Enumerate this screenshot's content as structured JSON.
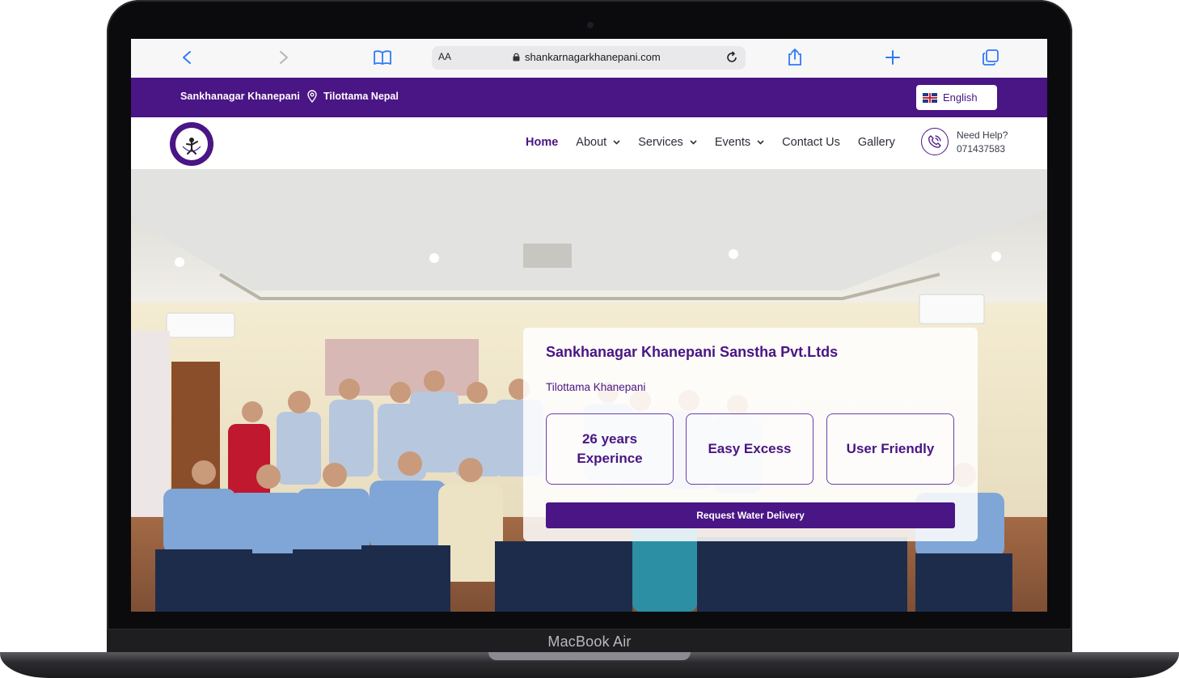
{
  "device": {
    "model_label": "MacBook Air"
  },
  "browser": {
    "text_size_label": "AA",
    "url": "shankarnagarkhanepani.com",
    "icons": [
      "back-icon",
      "forward-icon",
      "bookmarks-icon",
      "lock-icon",
      "reload-icon",
      "share-icon",
      "new-tab-icon",
      "tabs-icon"
    ]
  },
  "topbar": {
    "brand": "Sankhanagar Khanepani",
    "location": "Tilottama Nepal",
    "language": "English",
    "background": "#4a1584"
  },
  "nav": {
    "items": [
      {
        "label": "Home",
        "active": true,
        "dropdown": false
      },
      {
        "label": "About",
        "active": false,
        "dropdown": true
      },
      {
        "label": "Services",
        "active": false,
        "dropdown": true
      },
      {
        "label": "Events",
        "active": false,
        "dropdown": true
      },
      {
        "label": "Contact Us",
        "active": false,
        "dropdown": false
      },
      {
        "label": "Gallery",
        "active": false,
        "dropdown": false
      }
    ],
    "help_label": "Need Help?",
    "help_phone": "071437583"
  },
  "hero": {
    "title": "Sankhanagar Khanepani Sanstha Pvt.Ltds",
    "subtitle": "Tilottama Khanepani",
    "features": [
      "26 years\nExperince",
      "Easy Excess",
      "User Friendly"
    ],
    "cta_label": "Request Water Delivery"
  },
  "colors": {
    "brand_purple": "#4a1584",
    "link_blue": "#2f7af6"
  }
}
